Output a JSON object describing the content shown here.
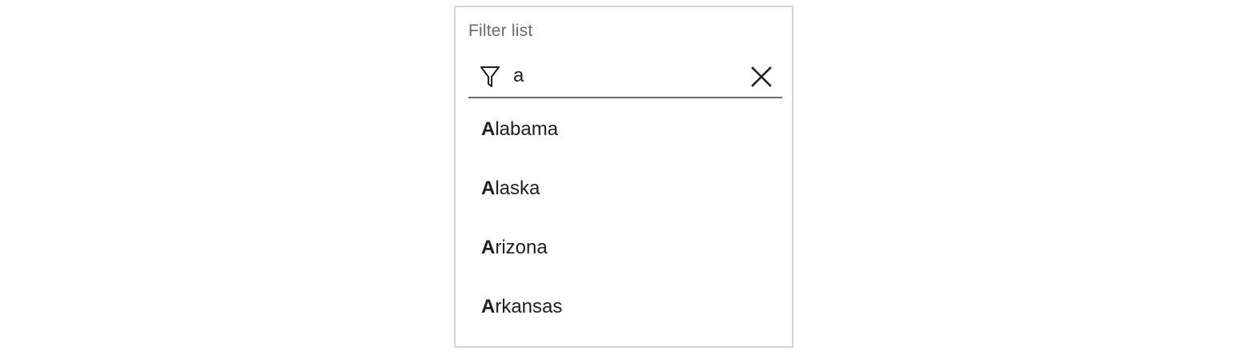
{
  "filter": {
    "label": "Filter list",
    "value": "a",
    "filter_icon": "filter-funnel-icon",
    "clear_icon": "close-x-icon"
  },
  "results": [
    {
      "match": "A",
      "rest": "labama"
    },
    {
      "match": "A",
      "rest": "laska"
    },
    {
      "match": "A",
      "rest": "rizona"
    },
    {
      "match": "A",
      "rest": "rkansas"
    }
  ],
  "colors": {
    "panel_border": "#d6d6d6",
    "underline": "#666a70",
    "label": "#6b6b6b",
    "text": "#1f1f1f"
  }
}
